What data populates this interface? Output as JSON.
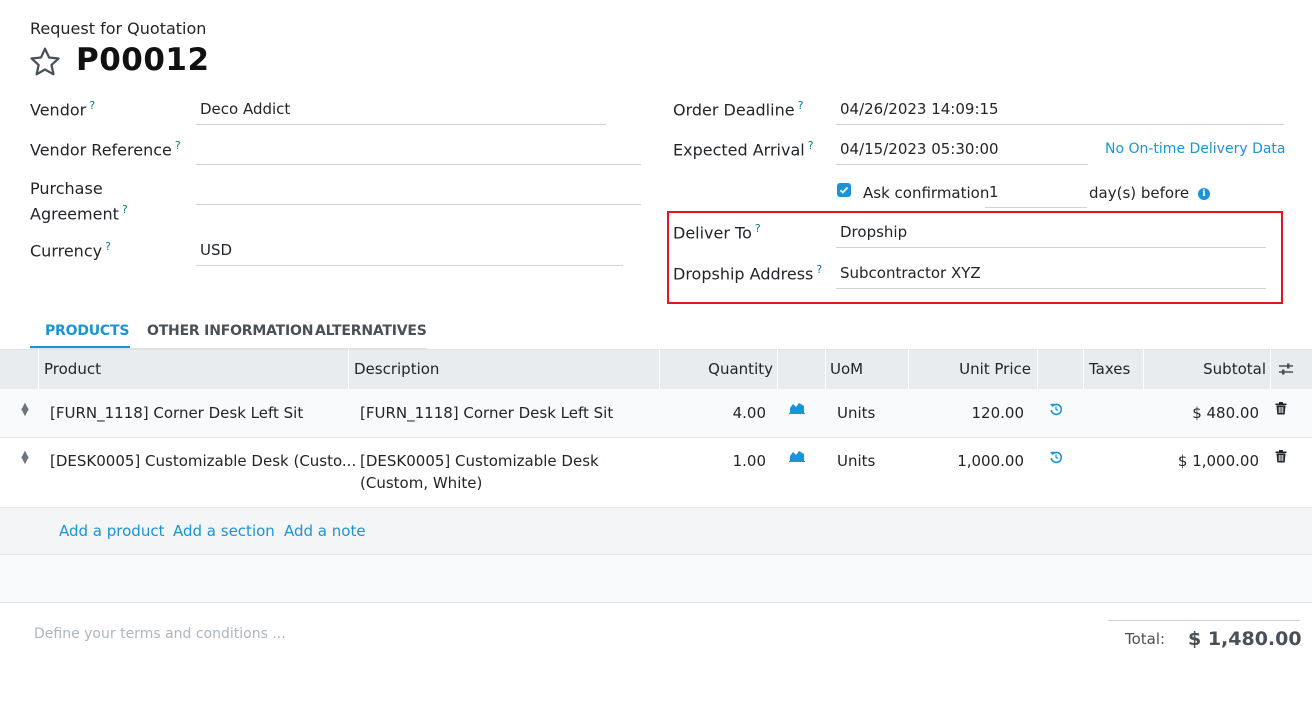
{
  "header": {
    "subtitle": "Request for Quotation",
    "title": "P00012"
  },
  "form": {
    "vendor": {
      "label": "Vendor",
      "help": "?",
      "value": "Deco Addict"
    },
    "vendor_reference": {
      "label": "Vendor Reference",
      "help": "?",
      "value": ""
    },
    "purchase_agreement": {
      "label_line1": "Purchase",
      "label_line2": "Agreement",
      "help": "?",
      "value": ""
    },
    "currency": {
      "label": "Currency",
      "help": "?",
      "value": "USD"
    },
    "order_deadline": {
      "label": "Order Deadline",
      "help": "?",
      "value": "04/26/2023 14:09:15"
    },
    "expected_arrival": {
      "label": "Expected Arrival",
      "help": "?",
      "value": "04/15/2023 05:30:00",
      "link": "No On-time Delivery Data"
    },
    "ask_confirmation": {
      "label": "Ask confirmation",
      "value": "1",
      "suffix": "day(s) before",
      "info_icon": "i",
      "checked": true
    },
    "deliver_to": {
      "label": "Deliver To",
      "help": "?",
      "value": "Dropship"
    },
    "dropship_address": {
      "label": "Dropship Address",
      "help": "?",
      "value": "Subcontractor XYZ"
    }
  },
  "tabs": [
    {
      "label": "PRODUCTS",
      "active": true
    },
    {
      "label": "OTHER INFORMATION",
      "active": false
    },
    {
      "label": "ALTERNATIVES",
      "active": false
    }
  ],
  "table": {
    "headers": {
      "product": "Product",
      "description": "Description",
      "quantity": "Quantity",
      "uom": "UoM",
      "unit_price": "Unit Price",
      "taxes": "Taxes",
      "subtotal": "Subtotal"
    },
    "rows": [
      {
        "product": "[FURN_1118] Corner Desk Left Sit",
        "description_line1": "[FURN_1118] Corner Desk Left Sit",
        "description_line2": "",
        "quantity": "4.00",
        "uom": "Units",
        "unit_price": "120.00",
        "taxes": "",
        "subtotal": "$ 480.00"
      },
      {
        "product": "[DESK0005] Customizable Desk (Custo...",
        "description_line1": "[DESK0005] Customizable Desk",
        "description_line2": "(Custom, White)",
        "quantity": "1.00",
        "uom": "Units",
        "unit_price": "1,000.00",
        "taxes": "",
        "subtotal": "$ 1,000.00"
      }
    ],
    "add_links": {
      "product": "Add a product",
      "section": "Add a section",
      "note": "Add a note"
    }
  },
  "footer": {
    "terms_placeholder": "Define your terms and conditions ...",
    "total_label": "Total:",
    "total_value": "$ 1,480.00"
  },
  "colors": {
    "accent": "#1a94d6",
    "help": "#017e84",
    "highlight_box": "#e8141c",
    "table_header_bg": "#e9ecef"
  },
  "icons": [
    "star-icon",
    "checkbox-icon",
    "info-icon",
    "drag-handle-icon",
    "forecast-chart-icon",
    "reset-price-icon",
    "trash-icon",
    "column-settings-icon"
  ]
}
